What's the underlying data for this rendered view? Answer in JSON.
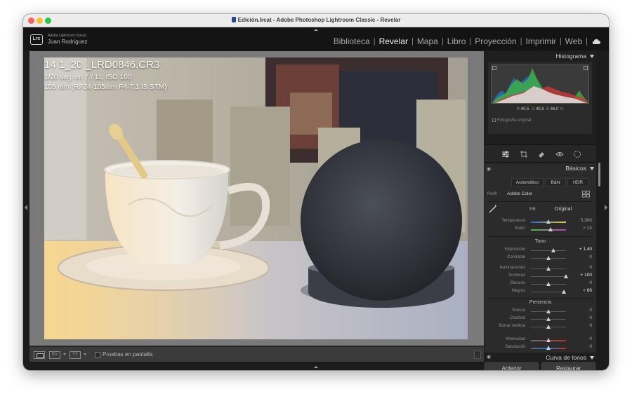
{
  "window": {
    "title": "Edición.lrcat - Adobe Photoshop Lightroom Classic - Revelar"
  },
  "identity": {
    "app": "Adobe Lightroom Classic",
    "user": "Juan Rodríguez",
    "logo": "Lrc"
  },
  "modules": [
    {
      "label": "Biblioteca",
      "active": false
    },
    {
      "label": "Revelar",
      "active": true
    },
    {
      "label": "Mapa",
      "active": false
    },
    {
      "label": "Libro",
      "active": false
    },
    {
      "label": "Proyección",
      "active": false
    },
    {
      "label": "Imprimir",
      "active": false
    },
    {
      "label": "Web",
      "active": false
    }
  ],
  "photo_info": {
    "filename": "14 1_20 _LRD0846.CR3",
    "exposure_prefix": "1/20 seg. en ƒ / 11, ISO 100",
    "lens": "105 mm (RF24-105mm F4-7.1 IS STM)"
  },
  "toolbar": {
    "soft_proof_label": "Pruebas en pantalla",
    "view_before_after_label": "RY",
    "view_yy_label": "YY"
  },
  "histogram": {
    "title": "Histograma",
    "readout": {
      "r": "40,5",
      "g": "40,8",
      "b": "46,0",
      "unit": "%"
    },
    "original_photo_label": "Fotografía original"
  },
  "basic": {
    "title": "Básicos",
    "buttons": {
      "auto": "Automático",
      "bw": "B&N",
      "hdr": "HDR"
    },
    "profile_label": "Perfil",
    "profile_value": "Adobe Color",
    "wb_label": "EB",
    "wb_value": "Original",
    "tone_title": "Tono",
    "presence_title": "Presencia",
    "rows": {
      "temperature": {
        "label": "Temperatura",
        "value": "5.300",
        "level": 0.5
      },
      "tint": {
        "label": "Matiz",
        "value": "+ 14",
        "level": 0.55
      },
      "exposure": {
        "label": "Exposición",
        "value": "+ 1,40",
        "level": 0.64
      },
      "contrast": {
        "label": "Contraste",
        "value": "0",
        "level": 0.5
      },
      "highlights": {
        "label": "Iluminaciones",
        "value": "0",
        "level": 0.5
      },
      "shadows": {
        "label": "Sombras",
        "value": "+ 100",
        "level": 1.0
      },
      "whites": {
        "label": "Blancos",
        "value": "0",
        "level": 0.5
      },
      "blacks": {
        "label": "Negros",
        "value": "+ 86",
        "level": 0.93
      },
      "texture": {
        "label": "Textura",
        "value": "0",
        "level": 0.5
      },
      "clarity": {
        "label": "Claridad",
        "value": "0",
        "level": 0.5
      },
      "dehaze": {
        "label": "Borrar neblina",
        "value": "0",
        "level": 0.5
      },
      "vibrance": {
        "label": "Intensidad",
        "value": "0",
        "level": 0.5
      },
      "saturation": {
        "label": "Saturación",
        "value": "0",
        "level": 0.5
      }
    }
  },
  "tone_curve": {
    "title": "Curva de tonos"
  },
  "buttons": {
    "previous": "Anterior",
    "reset": "Restaurar"
  },
  "icons": {
    "edit_tool": "sliders-icon",
    "crop": "crop-icon",
    "heal": "eraser-icon",
    "redeye": "eye-icon",
    "mask": "mask-icon",
    "cloud": "cloud-icon"
  },
  "colors": {
    "accent": "#f2f2f2",
    "panel": "#2b2b2b",
    "background": "#1c1c1c"
  }
}
